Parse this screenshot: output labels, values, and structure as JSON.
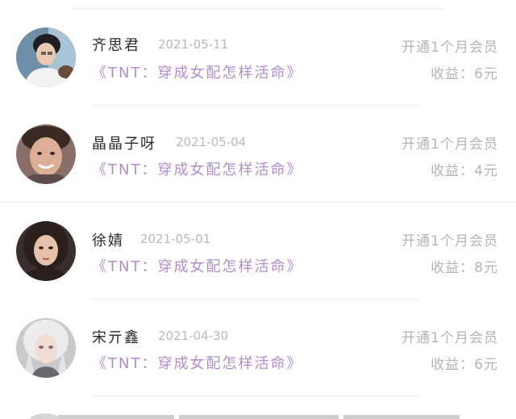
{
  "records": [
    {
      "user": "齐思君",
      "date": "2021-05-11",
      "plan": "开通1个月会员",
      "book": "《TNT：穿成女配怎样活命》",
      "earning": "收益：6元",
      "avatar_icon": "avatar-photo"
    },
    {
      "user": "晶晶子呀",
      "date": "2021-05-04",
      "plan": "开通1个月会员",
      "book": "《TNT：穿成女配怎样活命》",
      "earning": "收益：4元",
      "avatar_icon": "avatar-photo"
    },
    {
      "user": "徐婧",
      "date": "2021-05-01",
      "plan": "开通1个月会员",
      "book": "《TNT：穿成女配怎样活命》",
      "earning": "收益：8元",
      "avatar_icon": "avatar-photo"
    },
    {
      "user": "宋亓鑫",
      "date": "2021-04-30",
      "plan": "开通1个月会员",
      "book": "《TNT：穿成女配怎样活命》",
      "earning": "收益：6元",
      "avatar_icon": "avatar-photo"
    }
  ],
  "colors": {
    "book_title": "#b48ccd",
    "muted_text": "#b4b4b4",
    "date_text": "#b9b9b9",
    "name_text": "#2b2b2b"
  }
}
